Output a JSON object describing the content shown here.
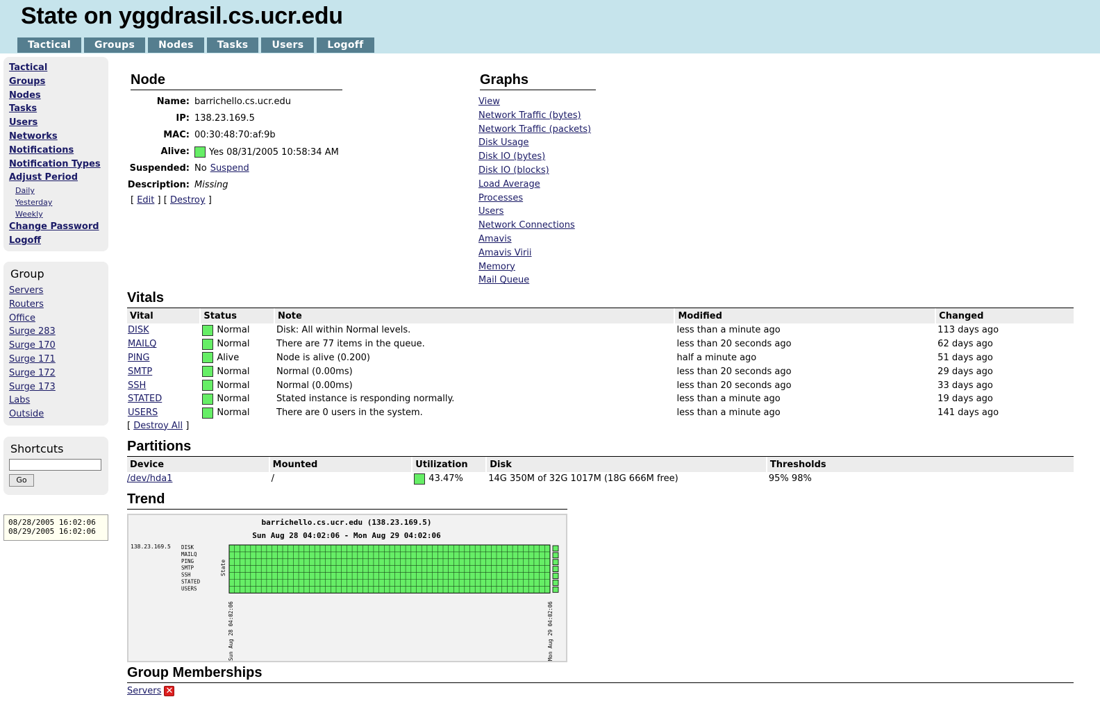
{
  "header": {
    "title": "State on yggdrasil.cs.ucr.edu",
    "tabs": [
      "Tactical",
      "Groups",
      "Nodes",
      "Tasks",
      "Users",
      "Logoff"
    ]
  },
  "sidebar": {
    "menu": [
      {
        "label": "Tactical"
      },
      {
        "label": "Groups"
      },
      {
        "label": "Nodes"
      },
      {
        "label": "Tasks"
      },
      {
        "label": "Users"
      },
      {
        "label": "Networks"
      },
      {
        "label": "Notifications"
      },
      {
        "label": "Notification Types"
      },
      {
        "label": "Adjust Period"
      }
    ],
    "period_sub": [
      "Daily",
      "Yesterday",
      "Weekly"
    ],
    "menu_bottom": [
      "Change Password",
      "Logoff"
    ],
    "group_title": "Group",
    "groups": [
      "Servers",
      "Routers",
      "Office",
      "Surge 283",
      "Surge 170",
      "Surge 171",
      "Surge 172",
      "Surge 173",
      "Labs",
      "Outside"
    ],
    "shortcuts_title": "Shortcuts",
    "shortcuts_value": "",
    "go_label": "Go",
    "dates": [
      "08/28/2005 16:02:06",
      "08/29/2005 16:02:06"
    ]
  },
  "node": {
    "title": "Node",
    "name_label": "Name:",
    "name": "barrichello.cs.ucr.edu",
    "ip_label": "IP:",
    "ip": "138.23.169.5",
    "mac_label": "MAC:",
    "mac": "00:30:48:70:af:9b",
    "alive_label": "Alive:",
    "alive": "Yes 08/31/2005 10:58:34 AM",
    "suspended_label": "Suspended:",
    "suspended": "No",
    "suspend_link": "Suspend",
    "description_label": "Description:",
    "description": "Missing",
    "edit": "Edit",
    "destroy": "Destroy",
    "bracket_open": "[",
    "bracket_close": "]"
  },
  "graphs": {
    "title": "Graphs",
    "links": [
      "View",
      "Network Traffic (bytes)",
      "Network Traffic (packets)",
      "Disk Usage",
      "Disk IO (bytes)",
      "Disk IO (blocks)",
      "Load Average",
      "Processes",
      "Users",
      "Network Connections",
      "Amavis",
      "Amavis Virii",
      "Memory",
      "Mail Queue"
    ]
  },
  "vitals": {
    "title": "Vitals",
    "columns": [
      "Vital",
      "Status",
      "Note",
      "Modified",
      "Changed"
    ],
    "rows": [
      {
        "vital": "DISK",
        "status": "Normal",
        "note": "Disk: All within Normal levels.",
        "modified": "less than a minute ago",
        "changed": "113 days ago"
      },
      {
        "vital": "MAILQ",
        "status": "Normal",
        "note": "There are 77 items in the queue.",
        "modified": "less than 20 seconds ago",
        "changed": "62 days ago"
      },
      {
        "vital": "PING",
        "status": "Alive",
        "note": "Node is alive (0.200)",
        "modified": "half a minute ago",
        "changed": "51 days ago"
      },
      {
        "vital": "SMTP",
        "status": "Normal",
        "note": "Normal (0.00ms)",
        "modified": "less than 20 seconds ago",
        "changed": "29 days ago"
      },
      {
        "vital": "SSH",
        "status": "Normal",
        "note": "Normal (0.00ms)",
        "modified": "less than 20 seconds ago",
        "changed": "33 days ago"
      },
      {
        "vital": "STATED",
        "status": "Normal",
        "note": "Stated instance is responding normally.",
        "modified": "less than a minute ago",
        "changed": "19 days ago"
      },
      {
        "vital": "USERS",
        "status": "Normal",
        "note": "There are 0 users in the system.",
        "modified": "less than a minute ago",
        "changed": "141 days ago"
      }
    ],
    "destroy_all": "Destroy All"
  },
  "partitions": {
    "title": "Partitions",
    "columns": [
      "Device",
      "Mounted",
      "Utilization",
      "Disk",
      "Thresholds"
    ],
    "rows": [
      {
        "device": "/dev/hda1",
        "mounted": "/",
        "utilization": "43.47%",
        "disk": "14G 350M of 32G 1017M (18G 666M free)",
        "thresholds": "95% 98%"
      }
    ]
  },
  "trend": {
    "title": "Trend",
    "chart_title": "barrichello.cs.ucr.edu (138.23.169.5)",
    "chart_subtitle": "Sun Aug 28 04:02:06 - Mon Aug 29 04:02:06",
    "host_label": "138.23.169.5",
    "y_axis_label": "State",
    "vitals": [
      "DISK",
      "MAILQ",
      "PING",
      "SMTP",
      "SSH",
      "STATED",
      "USERS"
    ],
    "x_start": "Sun Aug 28 04:02:06",
    "x_end": "Mon Aug 29 04:02:06",
    "state_color": "#66ee66"
  },
  "chart_data": {
    "type": "heatmap",
    "title": "barrichello.cs.ucr.edu (138.23.169.5)",
    "subtitle": "Sun Aug 28 04:02:06 - Mon Aug 29 04:02:06",
    "ylabel": "State",
    "categories": [
      "DISK",
      "MAILQ",
      "PING",
      "SMTP",
      "SSH",
      "STATED",
      "USERS"
    ],
    "x": [
      "Sun Aug 28 04:02:06",
      "Mon Aug 29 04:02:06"
    ],
    "values": [
      "Normal",
      "Normal",
      "Normal",
      "Normal",
      "Normal",
      "Normal",
      "Normal"
    ]
  },
  "memberships": {
    "title": "Group Memberships",
    "items": [
      "Servers"
    ]
  }
}
